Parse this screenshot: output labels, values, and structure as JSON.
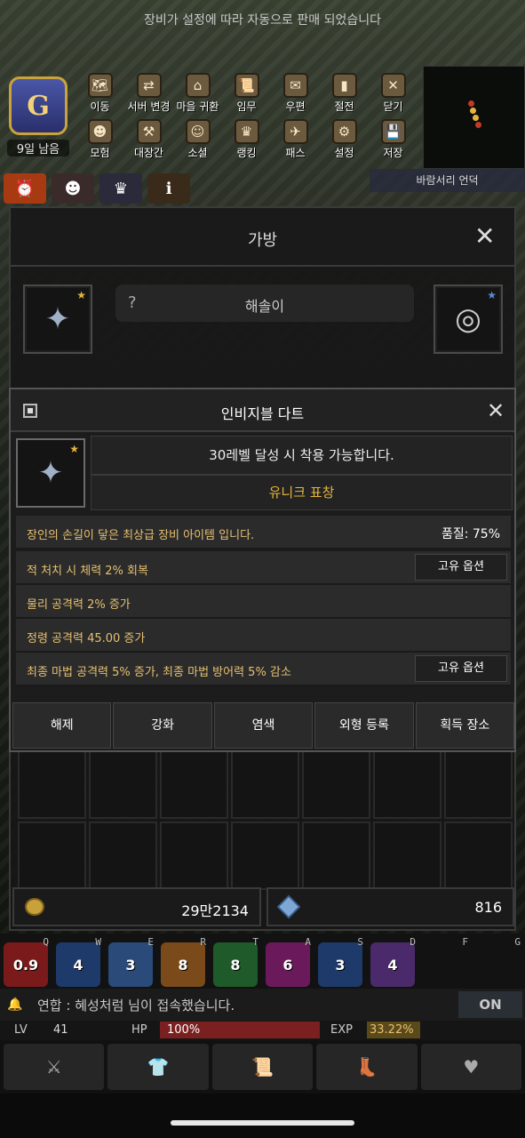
{
  "notice": "장비가 설정에 따라 자동으로 판매 되었습니다",
  "calendar": {
    "days_left": "9일 남음"
  },
  "menu": {
    "row1": [
      {
        "label": "이동",
        "icon": "map-icon"
      },
      {
        "label": "서버 변경",
        "icon": "server-icon"
      },
      {
        "label": "마을 귀환",
        "icon": "house-icon"
      },
      {
        "label": "임무",
        "icon": "scroll-icon"
      },
      {
        "label": "우편",
        "icon": "mail-icon"
      },
      {
        "label": "절전",
        "icon": "battery-icon"
      },
      {
        "label": "닫기",
        "icon": "close-icon"
      }
    ],
    "row2": [
      {
        "label": "모험",
        "icon": "adventurer-icon"
      },
      {
        "label": "대장간",
        "icon": "anvil-icon"
      },
      {
        "label": "소셜",
        "icon": "social-icon"
      },
      {
        "label": "랭킹",
        "icon": "trophy-icon"
      },
      {
        "label": "패스",
        "icon": "pass-icon"
      },
      {
        "label": "설정",
        "icon": "gear-icon"
      },
      {
        "label": "저장",
        "icon": "save-icon"
      }
    ]
  },
  "location": "바람서리 언덕",
  "bag": {
    "title": "가방",
    "description_label": "해솔이"
  },
  "popup": {
    "title": "인비지블 다트",
    "requirement": "30레벨 달성 시 착용 가능합니다.",
    "grade": "유니크 표창",
    "grade_color": "#e6b43c",
    "options": [
      {
        "text": "장인의 손길이 닿은 최상급 장비 아이템 입니다.",
        "right": "품질: 75%"
      },
      {
        "text": "적 처치 시 체력 2% 회복",
        "button": "고유 옵션"
      },
      {
        "text": "물리 공격력 2% 증가"
      },
      {
        "text": "정령 공격력 45.00 증가"
      },
      {
        "text": "최종 마법 공격력 5% 증가, 최종 마법 방어력 5% 감소",
        "button": "고유 옵션"
      }
    ],
    "buttons": [
      "해제",
      "강화",
      "염색",
      "외형 등록",
      "획득 장소"
    ]
  },
  "currency": {
    "gold": "29만2134",
    "gems": "816"
  },
  "skills": [
    {
      "key": "Q",
      "value": "0.9",
      "color": "#7a1a1a"
    },
    {
      "key": "W",
      "value": "4",
      "color": "#1e3a6a"
    },
    {
      "key": "E",
      "value": "3",
      "color": "#2a4a7a"
    },
    {
      "key": "R",
      "value": "8",
      "color": "#7a4a1a"
    },
    {
      "key": "T",
      "value": "8",
      "color": "#1e5a2a"
    },
    {
      "key": "A",
      "value": "6",
      "color": "#6a1a5a"
    },
    {
      "key": "S",
      "value": "3",
      "color": "#1e3a6a"
    },
    {
      "key": "D",
      "value": "4",
      "color": "#4a2a6a"
    },
    {
      "key": "F",
      "value": "",
      "color": "#121212"
    },
    {
      "key": "G",
      "value": "",
      "color": "#121212"
    }
  ],
  "chat": {
    "message": "연합 : 혜성처럼 님이 접속했습니다.",
    "toggle": "ON"
  },
  "stats": {
    "lv_label": "LV",
    "lv": "41",
    "hp_label": "HP",
    "hp": "100%",
    "exp_label": "EXP",
    "exp": "33.22%"
  },
  "bottom_nav": [
    "sword-icon",
    "armor-icon",
    "scroll-icon",
    "boot-icon",
    "heart-icon"
  ]
}
